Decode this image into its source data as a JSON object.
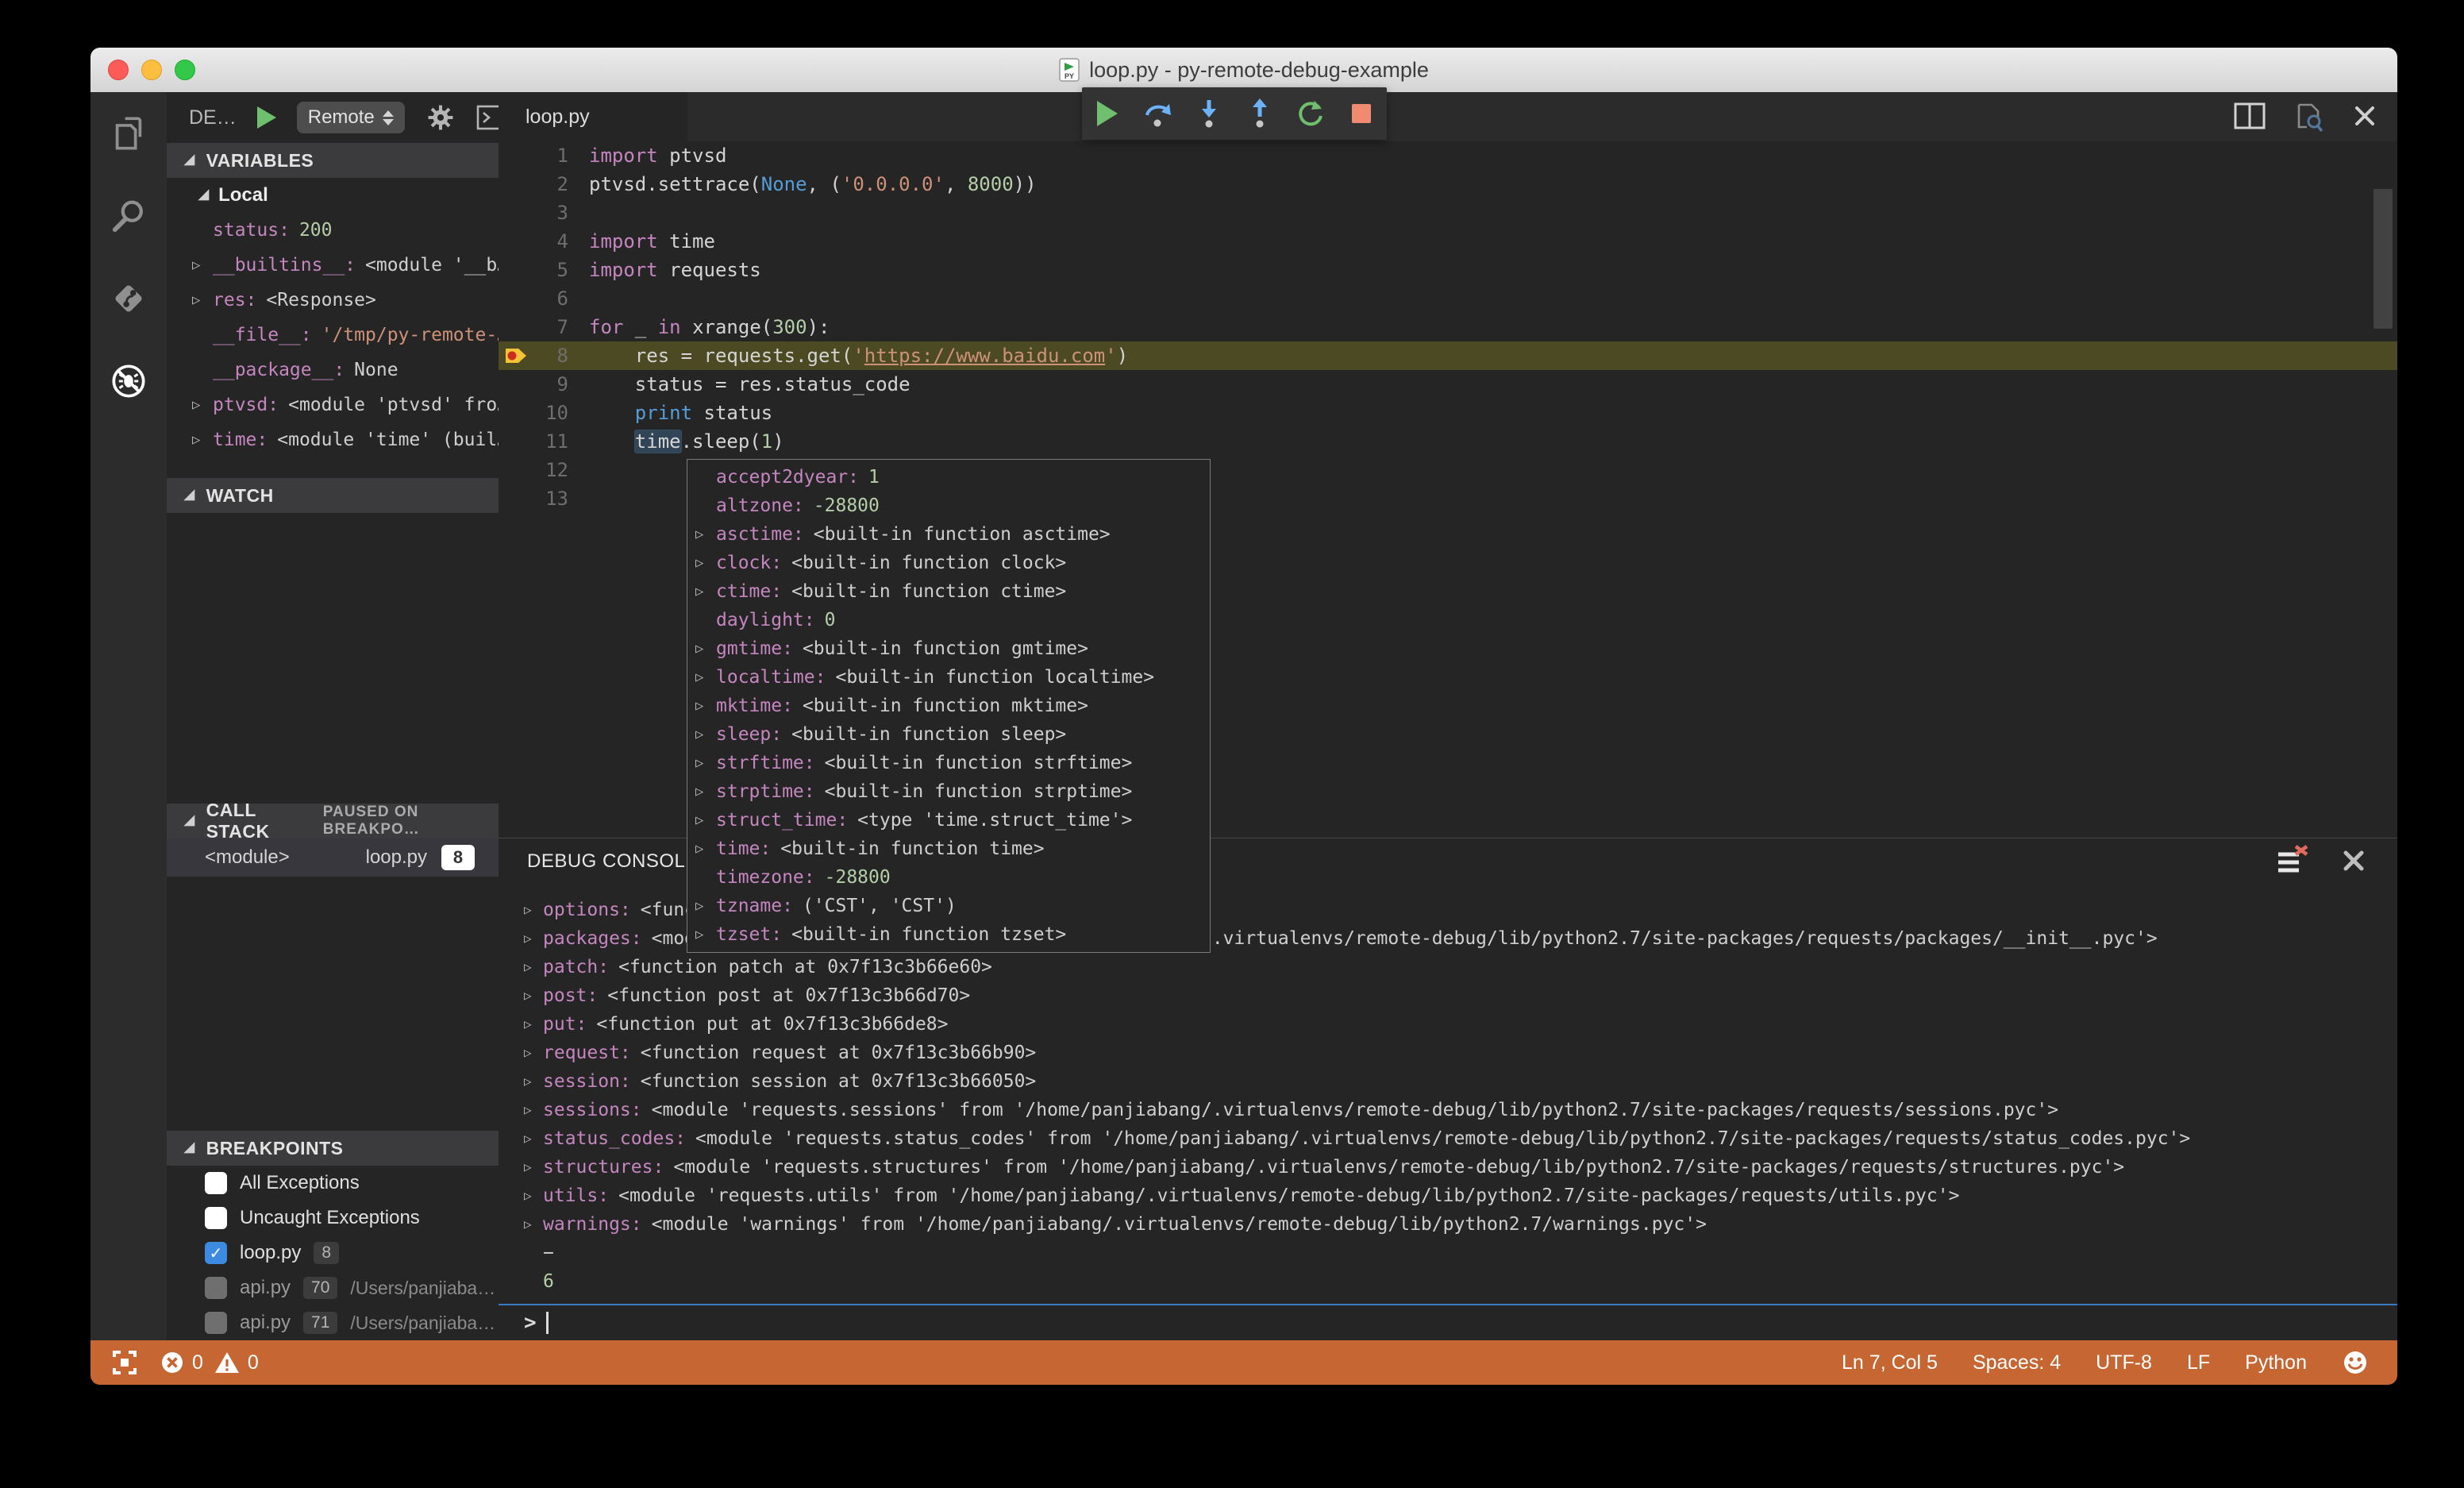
{
  "window": {
    "title": "loop.py - py-remote-debug-example"
  },
  "activity_bar": {
    "items": [
      "explorer",
      "search",
      "source-control",
      "debug"
    ],
    "active": "debug"
  },
  "sidebar": {
    "header": {
      "label": "DE…",
      "run_config": "Remote"
    },
    "variables": {
      "title": "VARIABLES",
      "scope_label": "Local",
      "items": [
        {
          "arrow": false,
          "name": "status",
          "value": "200",
          "vt": "num"
        },
        {
          "arrow": true,
          "name": "__builtins__",
          "value": "<module '__b…",
          "vt": "obj"
        },
        {
          "arrow": true,
          "name": "res",
          "value": "<Response>",
          "vt": "obj"
        },
        {
          "arrow": false,
          "name": "__file__",
          "value": "'/tmp/py-remote-…",
          "vt": "str"
        },
        {
          "arrow": false,
          "name": "__package__",
          "value": "None",
          "vt": "obj"
        },
        {
          "arrow": true,
          "name": "ptvsd",
          "value": "<module 'ptvsd' fro…",
          "vt": "obj"
        },
        {
          "arrow": true,
          "name": "time",
          "value": "<module 'time' (buil…",
          "vt": "obj"
        }
      ]
    },
    "watch": {
      "title": "WATCH"
    },
    "call_stack": {
      "title": "CALL STACK",
      "status_badge": "PAUSED ON BREAKPO…",
      "frames": [
        {
          "name": "<module>",
          "file": "loop.py",
          "line": "8"
        }
      ]
    },
    "breakpoints": {
      "title": "BREAKPOINTS",
      "items": [
        {
          "checked": false,
          "dim": false,
          "label": "All Exceptions"
        },
        {
          "checked": false,
          "dim": false,
          "label": "Uncaught Exceptions"
        },
        {
          "checked": true,
          "dim": false,
          "label": "loop.py",
          "badge": "8"
        },
        {
          "checked": false,
          "dim": true,
          "label": "api.py",
          "badge": "70",
          "path": "/Users/panjiaba…"
        },
        {
          "checked": false,
          "dim": true,
          "label": "api.py",
          "badge": "71",
          "path": "/Users/panjiaba…"
        }
      ]
    }
  },
  "editor": {
    "tab": "loop.py",
    "breakpoint_line": 8,
    "lines": [
      [
        [
          "k",
          "import"
        ],
        [
          "p",
          " ptvsd"
        ]
      ],
      [
        [
          "p",
          "ptvsd.settrace("
        ],
        [
          "b",
          "None"
        ],
        [
          "p",
          ", ("
        ],
        [
          "s",
          "'0.0.0.0'"
        ],
        [
          "p",
          ", "
        ],
        [
          "n",
          "8000"
        ],
        [
          "p",
          "))"
        ]
      ],
      [],
      [
        [
          "k",
          "import"
        ],
        [
          "p",
          " time"
        ]
      ],
      [
        [
          "k",
          "import"
        ],
        [
          "p",
          " requests"
        ]
      ],
      [],
      [
        [
          "k",
          "for"
        ],
        [
          "p",
          " _ "
        ],
        [
          "k",
          "in"
        ],
        [
          "p",
          " xrange("
        ],
        [
          "n",
          "300"
        ],
        [
          "p",
          "):"
        ]
      ],
      [
        [
          "p",
          "    res = requests.get("
        ],
        [
          "s",
          "'"
        ],
        [
          "u",
          "https://www.baidu.com"
        ],
        [
          "s",
          "'"
        ],
        [
          "p",
          ")"
        ]
      ],
      [
        [
          "p",
          "    status = res.status_code"
        ]
      ],
      [
        [
          "p",
          "    "
        ],
        [
          "b",
          "print"
        ],
        [
          "p",
          " status"
        ]
      ],
      [
        [
          "p",
          "    "
        ],
        [
          "hl",
          "time"
        ],
        [
          "p",
          ".sleep("
        ],
        [
          "n",
          "1"
        ],
        [
          "p",
          ")"
        ]
      ],
      [],
      []
    ]
  },
  "hover_tooltip": {
    "rows": [
      {
        "arrow": false,
        "name": "accept2dyear",
        "value": "1",
        "vt": "num"
      },
      {
        "arrow": false,
        "name": "altzone",
        "value": "-28800",
        "vt": "num"
      },
      {
        "arrow": true,
        "name": "asctime",
        "value": "<built-in function asctime>",
        "vt": "obj"
      },
      {
        "arrow": true,
        "name": "clock",
        "value": "<built-in function clock>",
        "vt": "obj"
      },
      {
        "arrow": true,
        "name": "ctime",
        "value": "<built-in function ctime>",
        "vt": "obj"
      },
      {
        "arrow": false,
        "name": "daylight",
        "value": "0",
        "vt": "num"
      },
      {
        "arrow": true,
        "name": "gmtime",
        "value": "<built-in function gmtime>",
        "vt": "obj"
      },
      {
        "arrow": true,
        "name": "localtime",
        "value": "<built-in function localtime>",
        "vt": "obj"
      },
      {
        "arrow": true,
        "name": "mktime",
        "value": "<built-in function mktime>",
        "vt": "obj"
      },
      {
        "arrow": true,
        "name": "sleep",
        "value": "<built-in function sleep>",
        "vt": "obj"
      },
      {
        "arrow": true,
        "name": "strftime",
        "value": "<built-in function strftime>",
        "vt": "obj"
      },
      {
        "arrow": true,
        "name": "strptime",
        "value": "<built-in function strptime>",
        "vt": "obj"
      },
      {
        "arrow": true,
        "name": "struct_time",
        "value": "<type 'time.struct_time'>",
        "vt": "obj"
      },
      {
        "arrow": true,
        "name": "time",
        "value": "<built-in function time>",
        "vt": "obj"
      },
      {
        "arrow": false,
        "name": "timezone",
        "value": "-28800",
        "vt": "num"
      },
      {
        "arrow": true,
        "name": "tzname",
        "value": "('CST', 'CST')",
        "vt": "obj"
      },
      {
        "arrow": true,
        "name": "tzset",
        "value": "<built-in function tzset>",
        "vt": "obj"
      }
    ]
  },
  "debug_console": {
    "tab": "DEBUG CONSOLE",
    "prompt": ">",
    "lines": [
      {
        "arrow": true,
        "name": "options",
        "value": "<func"
      },
      {
        "arrow": true,
        "name": "packages",
        "value": "<module 'requests.packages' from '/home/panjiabang/.virtualenvs/remote-debug/lib/python2.7/site-packages/requests/packages/__init__.pyc'>"
      },
      {
        "arrow": true,
        "name": "patch",
        "value": "<function patch at 0x7f13c3b66e60>"
      },
      {
        "arrow": true,
        "name": "post",
        "value": "<function post at 0x7f13c3b66d70>"
      },
      {
        "arrow": true,
        "name": "put",
        "value": "<function put at 0x7f13c3b66de8>"
      },
      {
        "arrow": true,
        "name": "request",
        "value": "<function request at 0x7f13c3b66b90>"
      },
      {
        "arrow": true,
        "name": "session",
        "value": "<function session at 0x7f13c3b66050>"
      },
      {
        "arrow": true,
        "name": "sessions",
        "value": "<module 'requests.sessions' from '/home/panjiabang/.virtualenvs/remote-debug/lib/python2.7/site-packages/requests/sessions.pyc'>"
      },
      {
        "arrow": true,
        "name": "status_codes",
        "value": "<module 'requests.status_codes' from '/home/panjiabang/.virtualenvs/remote-debug/lib/python2.7/site-packages/requests/status_codes.pyc'>"
      },
      {
        "arrow": true,
        "name": "structures",
        "value": "<module 'requests.structures' from '/home/panjiabang/.virtualenvs/remote-debug/lib/python2.7/site-packages/requests/structures.pyc'>"
      },
      {
        "arrow": true,
        "name": "utils",
        "value": "<module 'requests.utils' from '/home/panjiabang/.virtualenvs/remote-debug/lib/python2.7/site-packages/requests/utils.pyc'>"
      },
      {
        "arrow": true,
        "name": "warnings",
        "value": "<module 'warnings' from '/home/panjiabang/.virtualenvs/remote-debug/lib/python2.7/warnings.pyc'>"
      },
      {
        "text": "−",
        "cls": "c-plain"
      },
      {
        "text": "6",
        "cls": "c-num"
      }
    ]
  },
  "status_bar": {
    "error_count": "0",
    "warning_count": "0",
    "cursor": "Ln 7, Col 5",
    "indent": "Spaces: 4",
    "encoding": "UTF-8",
    "eol": "LF",
    "language": "Python"
  }
}
